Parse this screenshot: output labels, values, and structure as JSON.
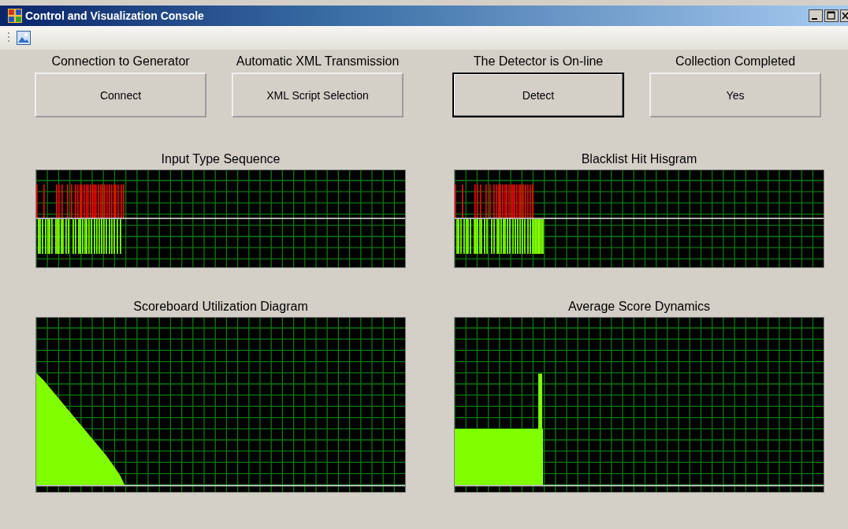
{
  "window": {
    "title": "Control and Visualization Console"
  },
  "actions": [
    {
      "label": "Connection to Generator",
      "button": "Connect",
      "focused": false
    },
    {
      "label": "Automatic XML Transmission",
      "button": "XML Script Selection",
      "focused": false
    },
    {
      "label": "The Detector is On-line",
      "button": "Detect",
      "focused": true
    },
    {
      "label": "Collection Completed",
      "button": "Yes",
      "focused": false
    }
  ],
  "charts": [
    {
      "title": "Input Type Sequence",
      "kind": "split_bars_short"
    },
    {
      "title": "Blacklist Hit Hisgram",
      "kind": "split_bars_long"
    },
    {
      "title": "Scoreboard Utilization Diagram",
      "kind": "decay_area"
    },
    {
      "title": "Average Score Dynamics",
      "kind": "step_area"
    }
  ]
}
